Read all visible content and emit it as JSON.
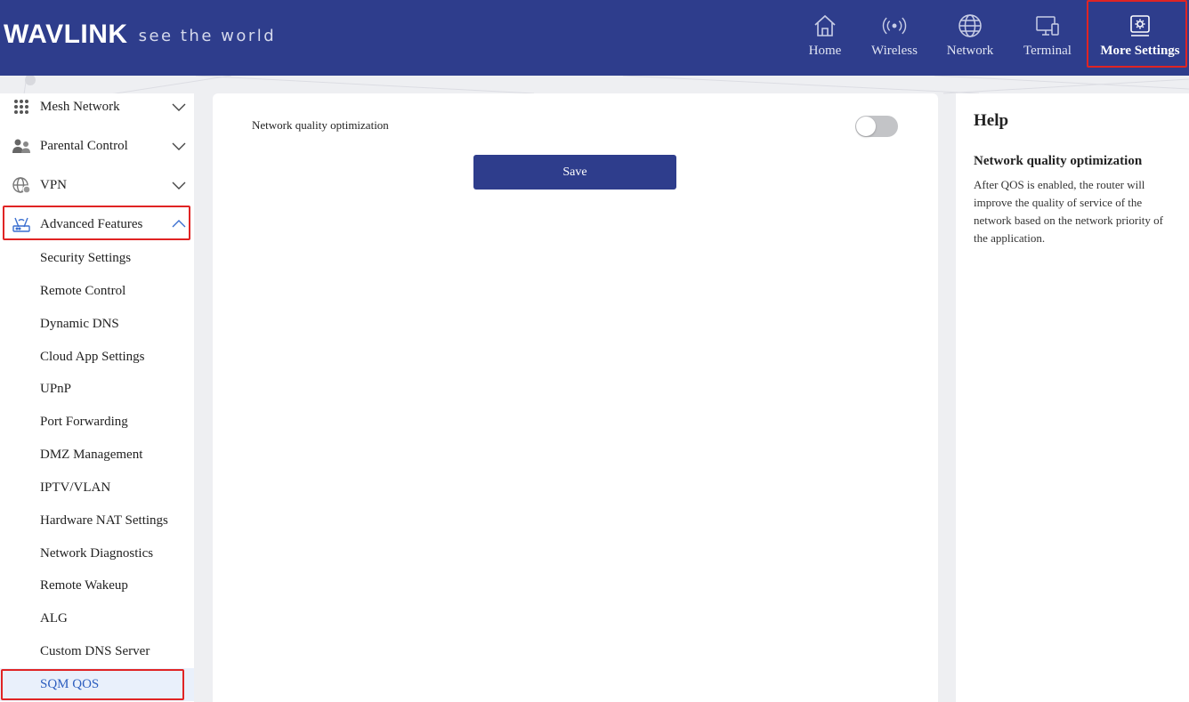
{
  "header": {
    "logo_word": "WAVLINK",
    "logo_tagline": "see the world",
    "nav": [
      {
        "label": "Home",
        "icon": "home-icon"
      },
      {
        "label": "Wireless",
        "icon": "wireless-icon"
      },
      {
        "label": "Network",
        "icon": "globe-icon"
      },
      {
        "label": "Terminal",
        "icon": "terminal-icon"
      },
      {
        "label": "More Settings",
        "icon": "gear-icon",
        "active": true
      }
    ]
  },
  "sidebar": {
    "groups": [
      {
        "label": "Mesh Network",
        "icon": "mesh-grid-icon",
        "expanded": false
      },
      {
        "label": "Parental Control",
        "icon": "parents-icon",
        "expanded": false
      },
      {
        "label": "VPN",
        "icon": "vpn-globe-icon",
        "expanded": false
      },
      {
        "label": "Advanced Features",
        "icon": "router-icon",
        "expanded": true
      }
    ],
    "sub_items": [
      "Security Settings",
      "Remote Control",
      "Dynamic DNS",
      "Cloud App Settings",
      "UPnP",
      "Port Forwarding",
      "DMZ Management",
      "IPTV/VLAN",
      "Hardware NAT Settings",
      "Network Diagnostics",
      "Remote Wakeup",
      "ALG",
      "Custom DNS Server",
      "SQM QOS"
    ],
    "selected_item": "SQM QOS"
  },
  "main": {
    "qos_label": "Network quality optimization",
    "qos_enabled": false,
    "save_label": "Save"
  },
  "help": {
    "title": "Help",
    "subtitle": "Network quality optimization",
    "text": "After QOS is enabled, the router will improve the quality of service of the network based on the network priority of the application."
  },
  "colors": {
    "header_bg": "#2e3d8c",
    "highlight_border": "#e02424",
    "selected_text": "#2e5fbf",
    "selected_bg": "#e9f0fb",
    "toggle_off": "#c3c4c7"
  }
}
